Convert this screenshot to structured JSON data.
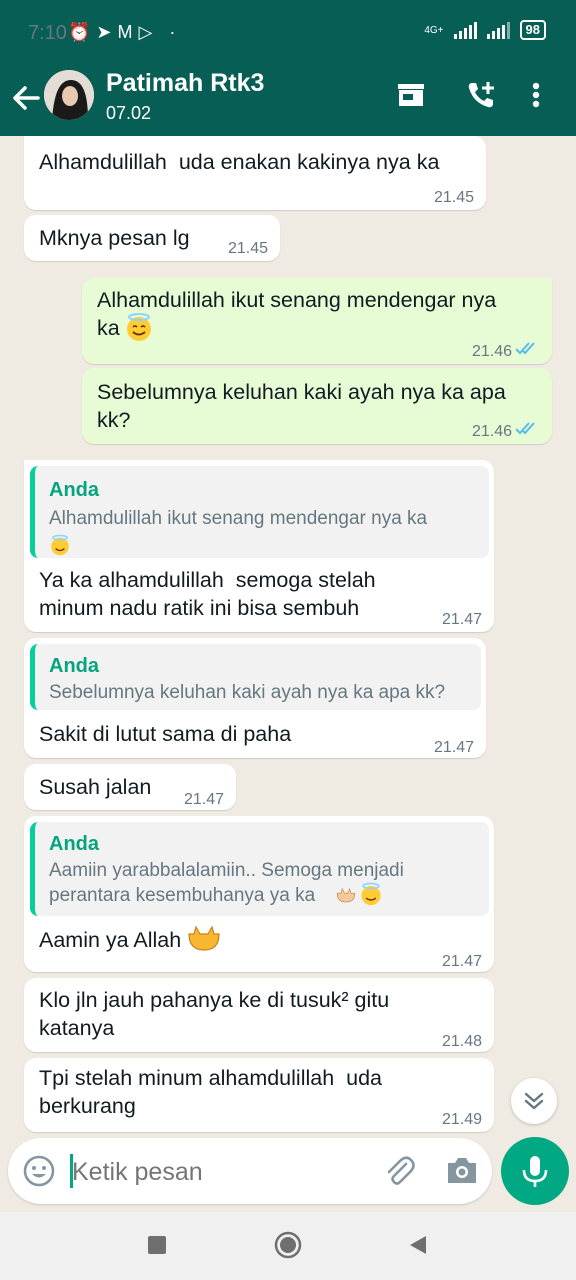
{
  "status_bar": {
    "time": "7:10",
    "network": "4G+",
    "battery": "98"
  },
  "header": {
    "contact_name": "Patimah Rtk3",
    "contact_status": "07.02"
  },
  "messages": [
    {
      "direction": "in",
      "text": "Alhamdulillah  uda enakan kakinya nya ka",
      "time": "21.45"
    },
    {
      "direction": "in",
      "text": "Mknya pesan lg",
      "time": "21.45"
    },
    {
      "direction": "out",
      "text": "Alhamdulillah ikut senang mendengar nya\nka",
      "emoji": "smiling-face-with-halo",
      "time": "21.46",
      "status": "read"
    },
    {
      "direction": "out",
      "text": "Sebelumnya keluhan kaki ayah nya ka apa\nkk?",
      "time": "21.46",
      "status": "read"
    },
    {
      "direction": "in",
      "quote_author": "Anda",
      "quote_text": "Alhamdulillah ikut senang mendengar nya ka",
      "quote_emoji": "smiling-face-with-halo",
      "text": "Ya ka alhamdulillah  semoga stelah\nminum nadu ratik ini bisa sembuh",
      "time": "21.47"
    },
    {
      "direction": "in",
      "quote_author": "Anda",
      "quote_text": "Sebelumnya keluhan kaki ayah nya ka apa kk?",
      "text": "Sakit di lutut sama di paha",
      "time": "21.47"
    },
    {
      "direction": "in",
      "text": "Susah jalan",
      "time": "21.47"
    },
    {
      "direction": "in",
      "quote_author": "Anda",
      "quote_text": "Aamiin yarabbalalamiin.. Semoga menjadi\nperantara kesembuhanya ya ka",
      "quote_emoji": "palms-up-together, smiling-face-with-halo",
      "text": "Aamin ya Allah",
      "emoji": "palms-up-together",
      "time": "21.47"
    },
    {
      "direction": "in",
      "text": "Klo jln jauh pahanya ke di tusuk² gitu\nkatanya",
      "time": "21.48"
    },
    {
      "direction": "in",
      "text": "Tpi stelah minum alhamdulillah  uda\nberkurang",
      "time": "21.49"
    }
  ],
  "composer": {
    "placeholder": "Ketik pesan"
  },
  "colors": {
    "header": "#075e54",
    "outgoing_bubble": "#e7fcd5",
    "accent": "#00a884",
    "read_ticks": "#53bdeb"
  }
}
